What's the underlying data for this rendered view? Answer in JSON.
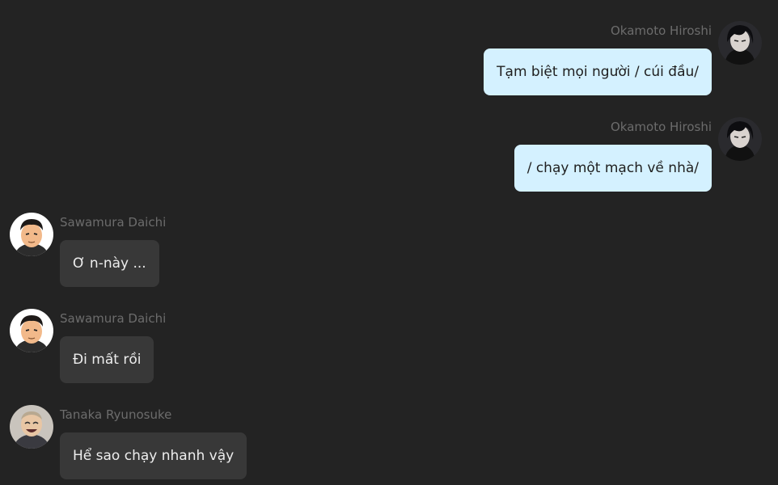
{
  "messages": [
    {
      "sender": "Okamoto Hiroshi",
      "text": "Tạm biệt mọi người / cúi đầu/",
      "side": "right",
      "avatar": "okamoto-avatar"
    },
    {
      "sender": "Okamoto Hiroshi",
      "text": "/ chạy một mạch về nhà/",
      "side": "right",
      "avatar": "okamoto-avatar"
    },
    {
      "sender": "Sawamura Daichi",
      "text": "Ơ n-này ...",
      "side": "left",
      "avatar": "sawamura-avatar"
    },
    {
      "sender": "Sawamura Daichi",
      "text": "Đi mất rồi",
      "side": "left",
      "avatar": "sawamura-avatar"
    },
    {
      "sender": "Tanaka Ryunosuke",
      "text": "Hể sao chạy nhanh vậy",
      "side": "left",
      "avatar": "tanaka-avatar"
    }
  ],
  "colors": {
    "background": "#232323",
    "outgoing_bubble": "#d4f1ff",
    "incoming_bubble": "#383838",
    "sender_name": "#6c6c6c"
  }
}
